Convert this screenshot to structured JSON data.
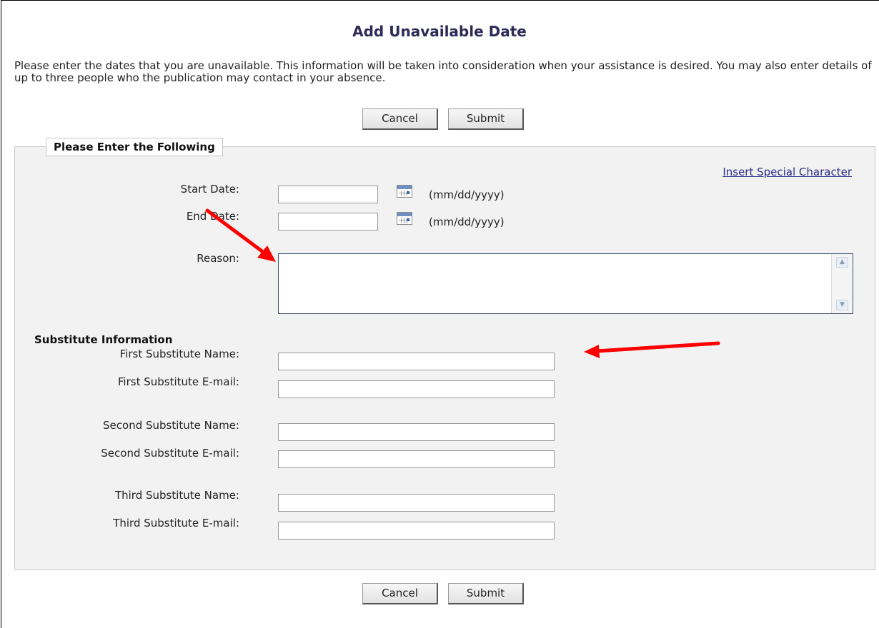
{
  "page": {
    "title": "Add Unavailable Date",
    "intro": "Please enter the dates that you are unavailable. This information will be taken into consideration when your assistance is desired. You may also enter details of up to three people who the publication may contact in your absence."
  },
  "buttons": {
    "cancel": "Cancel",
    "submit": "Submit"
  },
  "form": {
    "legend": "Please Enter the Following",
    "special_char_link": "Insert Special Character",
    "start_date": {
      "label": "Start Date:",
      "value": "",
      "format": "(mm/dd/yyyy)"
    },
    "end_date": {
      "label": "End Date:",
      "value": "",
      "format": "(mm/dd/yyyy)"
    },
    "reason": {
      "label": "Reason:",
      "value": ""
    },
    "substitute_heading": "Substitute Information",
    "substitutes": [
      {
        "name_label": "First Substitute Name:",
        "email_label": "First Substitute E-mail:"
      },
      {
        "name_label": "Second Substitute Name:",
        "email_label": "Second Substitute E-mail:"
      },
      {
        "name_label": "Third Substitute Name:",
        "email_label": "Third Substitute E-mail:"
      }
    ]
  },
  "icons": {
    "calendar": "calendar-icon",
    "scroll_up": "scroll-up-icon",
    "scroll_down": "scroll-down-icon"
  },
  "colors": {
    "title": "#2b2b57",
    "link": "#2a2a8a",
    "annotation_arrow": "#ff0000",
    "fieldset_bg": "#f2f2f2"
  }
}
